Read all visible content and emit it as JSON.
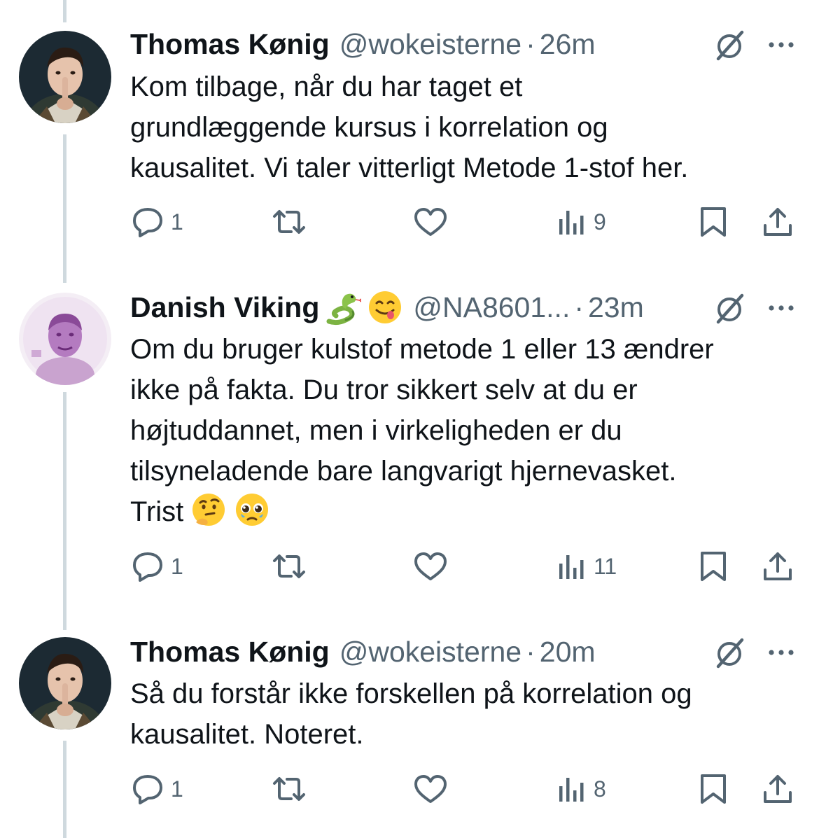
{
  "tweets": [
    {
      "author_name": "Thomas Kønig",
      "handle": "@wokeisterne",
      "separator": "·",
      "time": "26m",
      "avatar": "portrait-avatar",
      "body_lines": [
        "Kom tilbage, når du har taget et",
        "grundlæggende kursus i korrelation og",
        "kausalitet. Vi taler vitterligt Metode 1-stof her."
      ],
      "reply_count": "1",
      "view_count": "9"
    },
    {
      "author_name": "Danish Viking",
      "name_emojis": [
        "snake-emoji",
        "yum-face-emoji"
      ],
      "handle": "@NA8601...",
      "separator": "·",
      "time": "23m",
      "avatar": "purple-tinted-avatar",
      "body_lines": [
        "Om du bruger kulstof metode 1 eller 13 ændrer",
        "ikke på fakta. Du tror sikkert selv at du er",
        "højtuddannet, men i virkeligheden er du",
        "tilsyneladende bare langvarigt hjernevasket.",
        "Trist"
      ],
      "trailing_emojis": [
        "thinking-face-emoji",
        "pleading-face-emoji"
      ],
      "reply_count": "1",
      "view_count": "11"
    },
    {
      "author_name": "Thomas Kønig",
      "handle": "@wokeisterne",
      "separator": "·",
      "time": "20m",
      "avatar": "portrait-avatar",
      "body_lines": [
        "Så du forstår ikke forskellen på korrelation og",
        "kausalitet. Noteret."
      ],
      "reply_count": "1",
      "view_count": "8"
    }
  ],
  "icons": {
    "grok": "grok-icon",
    "more": "more-icon",
    "reply": "reply-icon",
    "retweet": "retweet-icon",
    "like": "like-icon",
    "views": "views-icon",
    "bookmark": "bookmark-icon",
    "share": "share-icon"
  },
  "colors": {
    "text": "#0f1419",
    "secondary": "#536471",
    "thread_line": "#cfd9de",
    "background": "#ffffff"
  }
}
